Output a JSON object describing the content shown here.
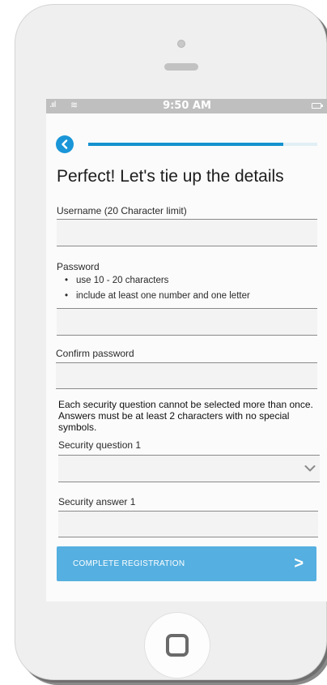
{
  "status_bar": {
    "signal": ".ııl",
    "wifi": "≋",
    "time": "9:50 AM"
  },
  "header": {
    "progress": 0.85,
    "title": "Perfect! Let's tie up the details"
  },
  "form": {
    "username_label": "Username (20 Character limit)",
    "password_label": "Password",
    "password_rules": [
      "use 10 - 20 characters",
      "include at least one number and one letter"
    ],
    "confirm_label": "Confirm password",
    "security_note": "Each security question cannot be selected more than once. Answers must be at least 2 characters with no special symbols.",
    "question1_label": "Security question 1",
    "question1_value": "",
    "answer1_label": "Security answer 1"
  },
  "cta": {
    "label": "COMPLETE REGISTRATION",
    "arrow": ">"
  },
  "colors": {
    "accent": "#1592cf",
    "button": "#55afe0"
  }
}
